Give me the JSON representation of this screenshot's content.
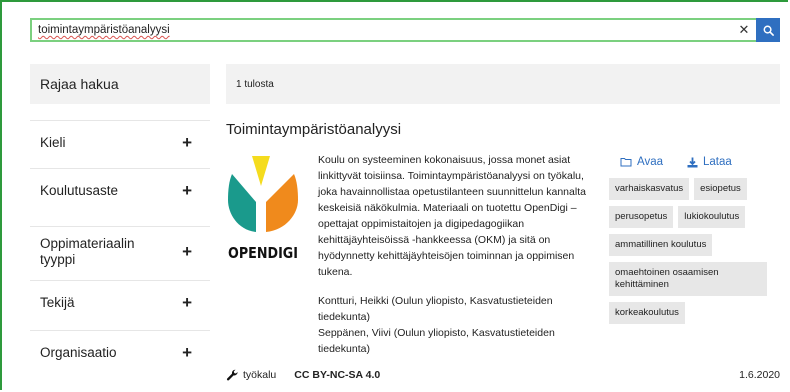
{
  "search": {
    "value": "toimintaympäristöanalyysi",
    "clear_icon": "close-icon",
    "search_icon": "search-icon"
  },
  "sidebar": {
    "title": "Rajaa hakua",
    "items": [
      {
        "label": "Kieli"
      },
      {
        "label": "Koulutusaste"
      },
      {
        "label": "Oppimateriaalin tyyppi"
      },
      {
        "label": "Tekijä"
      },
      {
        "label": "Organisaatio"
      }
    ]
  },
  "results": {
    "count_text": "1 tulosta",
    "item": {
      "title": "Toimintaympäristöanalyysi",
      "logo_text": "OPENDIGI",
      "description": "Koulu on systeeminen kokonaisuus, jossa monet asiat linkittyvät toisiinsa. Toimintaympäristöanalyysi on työkalu, joka havainnollistaa opetustilanteen suunnittelun kannalta keskeisiä näkökulmia. Materiaali on tuotettu OpenDigi – opettajat oppimistaitojen ja digipedagogiikan kehittäjäyhteisöissä -hankkeessa (OKM) ja sitä on hyödynnetty kehittäjäyhteisöjen toiminnan ja oppimisen tukena.",
      "authors": [
        "Kontturi, Heikki (Oulun yliopisto, Kasvatustieteiden tiedekunta)",
        "Seppänen, Viivi (Oulun yliopisto, Kasvatustieteiden tiedekunta)"
      ],
      "open_label": "Avaa",
      "download_label": "Lataa",
      "tags": [
        "varhaiskasvatus",
        "esiopetus",
        "perusopetus",
        "lukiokoulutus",
        "ammatillinen koulutus",
        "omaehtoinen osaamisen kehittäminen",
        "korkeakoulutus"
      ],
      "type_label": "työkalu",
      "license": "CC BY-NC-SA 4.0",
      "date": "1.6.2020"
    }
  },
  "colors": {
    "accent": "#2f6fc0",
    "frame": "#2e9a3c",
    "logo_yellow": "#f5dc1e",
    "logo_teal": "#1a9a8c",
    "logo_orange": "#f08a1c"
  }
}
